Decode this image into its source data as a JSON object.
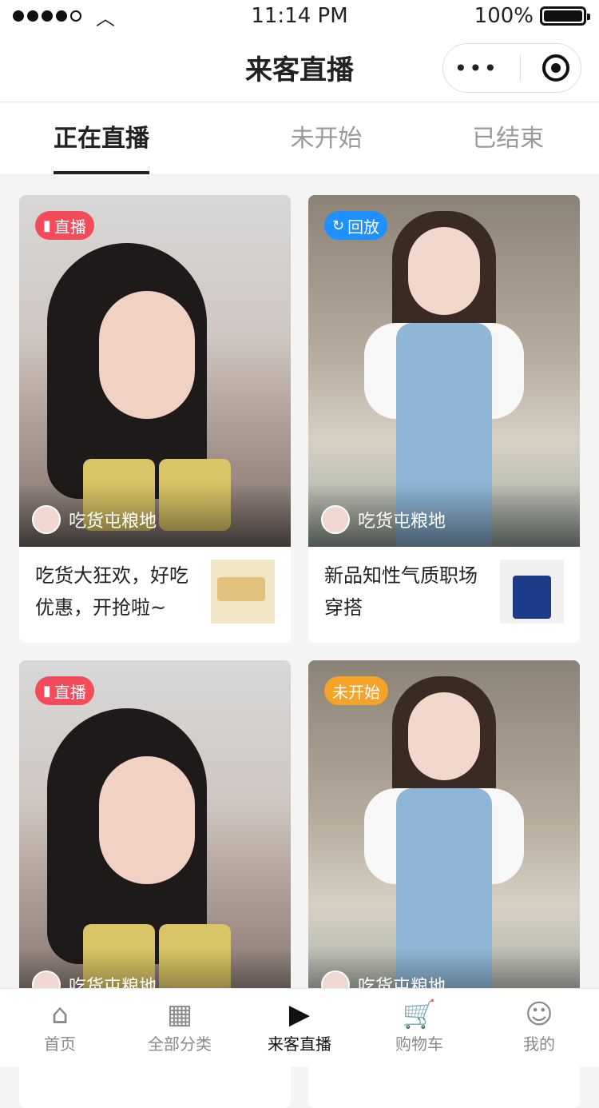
{
  "status_bar": {
    "time": "11:14 PM",
    "battery": "100%"
  },
  "nav": {
    "title": "来客直播"
  },
  "tabs": [
    {
      "label": "正在直播",
      "active": true
    },
    {
      "label": "未开始",
      "active": false
    },
    {
      "label": "已结束",
      "active": false
    }
  ],
  "cards": [
    {
      "badge": "直播",
      "badge_icon": "chart-bars-icon",
      "badge_color": "#f24b5a",
      "anchor": "吃货屯粮地",
      "title": "吃货大狂欢，好吃优惠，开抢啦~",
      "thumb": "wafer-snack"
    },
    {
      "badge": "回放",
      "badge_icon": "replay-icon",
      "badge_color": "#1e90ff",
      "anchor": "吃货屯粮地",
      "title": "新品知性气质职场穿搭",
      "thumb": "denim-overall"
    },
    {
      "badge": "直播",
      "badge_icon": "chart-bars-icon",
      "badge_color": "#f24b5a",
      "anchor": "吃货屯粮地",
      "title": "",
      "thumb": ""
    },
    {
      "badge": "未开始",
      "badge_icon": "",
      "badge_color": "#f6a32a",
      "anchor": "吃货屯粮地",
      "title": "",
      "thumb": ""
    }
  ],
  "tabbar": [
    {
      "label": "首页",
      "icon": "home-icon"
    },
    {
      "label": "全部分类",
      "icon": "category-search-icon"
    },
    {
      "label": "来客直播",
      "icon": "live-video-icon",
      "active": true
    },
    {
      "label": "购物车",
      "icon": "cart-icon"
    },
    {
      "label": "我的",
      "icon": "user-icon"
    }
  ]
}
